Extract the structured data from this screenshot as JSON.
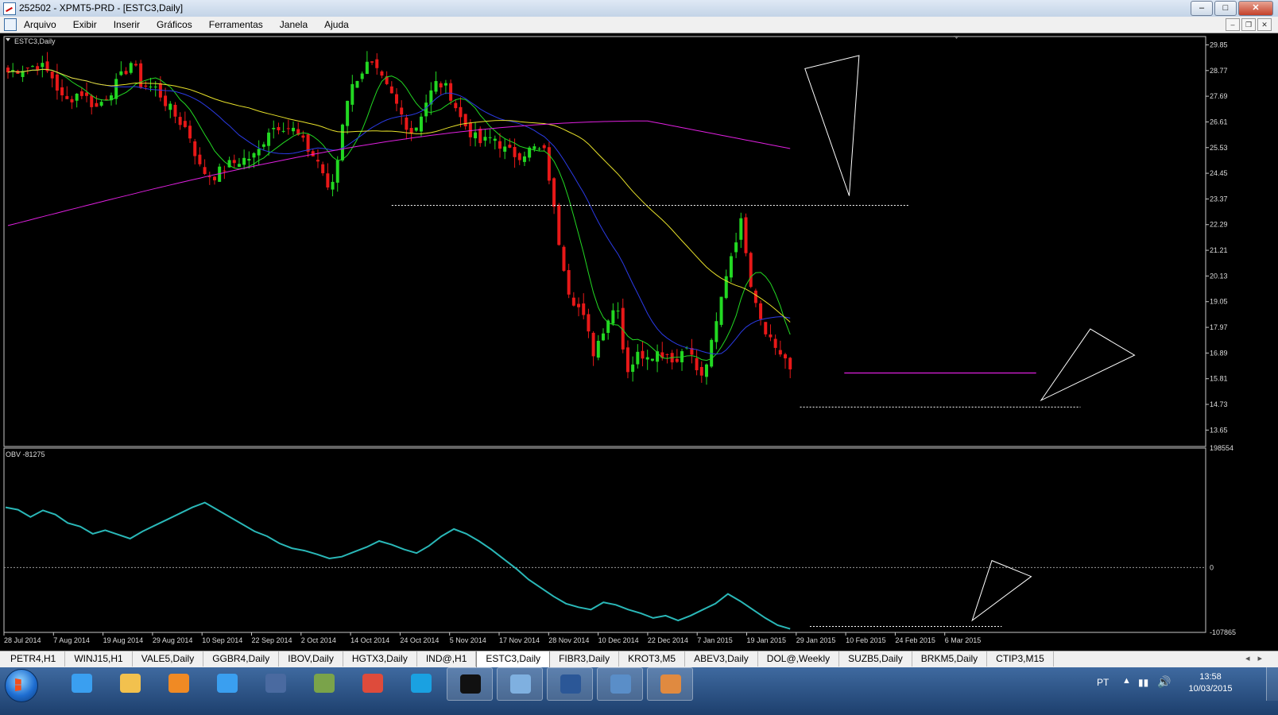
{
  "window": {
    "title": "252502 - XPMT5-PRD - [ESTC3,Daily]",
    "minimize": "–",
    "maximize": "□",
    "close": "✕"
  },
  "menu": {
    "items": [
      "Arquivo",
      "Exibir",
      "Inserir",
      "Gráficos",
      "Ferramentas",
      "Janela",
      "Ajuda"
    ]
  },
  "chart_data": [
    {
      "type": "candlestick",
      "title": "ESTC3,Daily",
      "ylim": [
        12.96,
        30.2
      ],
      "y_ticks": [
        "29.85",
        "28.77",
        "27.69",
        "26.61",
        "25.53",
        "24.45",
        "23.37",
        "22.29",
        "21.21",
        "20.13",
        "19.05",
        "17.97",
        "16.89",
        "15.81",
        "14.73",
        "13.65"
      ],
      "x_ticks": [
        "28 Jul 2014",
        "7 Aug 2014",
        "19 Aug 2014",
        "29 Aug 2014",
        "10 Sep 2014",
        "22 Sep 2014",
        "2 Oct 2014",
        "14 Oct 2014",
        "24 Oct 2014",
        "5 Nov 2014",
        "17 Nov 2014",
        "28 Nov 2014",
        "10 Dec 2014",
        "22 Dec 2014",
        "7 Jan 2015",
        "19 Jan 2015",
        "29 Jan 2015",
        "10 Feb 2015",
        "24 Feb 2015",
        "6 Mar 2015"
      ],
      "bar_count": 160,
      "close_anchors": [
        [
          0,
          28.7
        ],
        [
          4,
          28.9
        ],
        [
          8,
          29.0
        ],
        [
          11,
          28.5
        ],
        [
          14,
          27.4
        ],
        [
          18,
          27.9
        ],
        [
          22,
          27.2
        ],
        [
          27,
          28.2
        ],
        [
          31,
          29.2
        ],
        [
          33,
          28.2
        ],
        [
          37,
          28.0
        ],
        [
          41,
          27.0
        ],
        [
          45,
          26.2
        ],
        [
          48,
          24.6
        ],
        [
          51,
          24.3
        ],
        [
          55,
          24.8
        ],
        [
          58,
          25.0
        ],
        [
          62,
          25.2
        ],
        [
          65,
          26.3
        ],
        [
          68,
          26.5
        ],
        [
          71,
          26.3
        ],
        [
          75,
          25.4
        ],
        [
          78,
          24.8
        ],
        [
          80,
          23.5
        ],
        [
          82,
          24.8
        ],
        [
          84,
          27.4
        ],
        [
          87,
          28.5
        ],
        [
          90,
          29.1
        ],
        [
          93,
          28.4
        ],
        [
          96,
          27.6
        ],
        [
          99,
          26.6
        ],
        [
          101,
          26.1
        ],
        [
          104,
          27.4
        ],
        [
          107,
          28.3
        ],
        [
          110,
          27.9
        ],
        [
          113,
          26.7
        ],
        [
          116,
          26.0
        ],
        [
          118,
          25.7
        ],
        [
          121,
          26.0
        ],
        [
          124,
          25.4
        ],
        [
          127,
          25.2
        ],
        [
          131,
          25.5
        ],
        [
          134,
          25.3
        ],
        [
          137,
          21.9
        ],
        [
          140,
          19.4
        ],
        [
          143,
          18.6
        ],
        [
          146,
          16.9
        ],
        [
          149,
          18.2
        ],
        [
          152,
          19.0
        ],
        [
          154,
          16.1
        ],
        [
          157,
          16.8
        ],
        [
          160,
          16.9
        ],
        [
          164,
          16.9
        ],
        [
          167,
          16.5
        ],
        [
          169,
          17.5
        ],
        [
          171,
          16.4
        ],
        [
          173,
          15.8
        ],
        [
          176,
          17.6
        ],
        [
          179,
          20.2
        ],
        [
          181,
          21.5
        ],
        [
          183,
          22.5
        ],
        [
          185,
          20.0
        ],
        [
          188,
          18.2
        ],
        [
          191,
          17.2
        ],
        [
          194,
          16.6
        ],
        [
          195,
          16.0
        ]
      ],
      "indicators": [
        {
          "kind": "moving_average",
          "period": 9,
          "color": "#22d822"
        },
        {
          "kind": "moving_average",
          "period": 21,
          "color": "#2b3be6"
        },
        {
          "kind": "moving_average",
          "period": 50,
          "color": "#e8e22a"
        },
        {
          "kind": "moving_average",
          "period": 200,
          "color": "#e020e0"
        }
      ],
      "annotations": [
        {
          "kind": "support_line",
          "price": 23.1,
          "from_bar": 78,
          "to_bar": 183,
          "color": "#ffffff"
        },
        {
          "kind": "support_line",
          "price": 14.62,
          "from_bar": 161,
          "to_bar": 218,
          "color": "#ffffff"
        },
        {
          "kind": "horizontal_line",
          "price": 16.05,
          "from_bar": 170,
          "to_bar": 209,
          "color": "#e020e0"
        },
        {
          "kind": "triangle",
          "points": [
            [
              162,
              28.85
            ],
            [
              173,
              29.4
            ],
            [
              171,
              23.5
            ]
          ]
        },
        {
          "kind": "triangle",
          "points": [
            [
              210,
              14.9
            ],
            [
              220,
              17.9
            ],
            [
              229,
              16.8
            ]
          ]
        }
      ]
    },
    {
      "type": "line",
      "title": "OBV -81275",
      "ylim": [
        -107865,
        198554
      ],
      "y_ticks": [
        "198554",
        "0",
        "-107865"
      ],
      "series": [
        {
          "color": "#2ab8b8",
          "values": [
            100000,
            96000,
            84000,
            95000,
            88000,
            74000,
            68000,
            56000,
            62000,
            55000,
            48000,
            60000,
            70000,
            80000,
            90000,
            100000,
            108000,
            96000,
            84000,
            72000,
            60000,
            52000,
            40000,
            32000,
            28000,
            22000,
            15000,
            18000,
            26000,
            34000,
            44000,
            38000,
            30000,
            24000,
            36000,
            52000,
            64000,
            56000,
            44000,
            30000,
            14000,
            -2000,
            -20000,
            -34000,
            -48000,
            -60000,
            -66000,
            -70000,
            -58000,
            -62000,
            -70000,
            -76000,
            -84000,
            -80000,
            -88000,
            -80000,
            -70000,
            -60000,
            -44000,
            -56000,
            -70000,
            -84000,
            -96000,
            -102000
          ]
        },
        {
          "name": "OBV",
          "y": [
            0
          ]
        }
      ],
      "annotations": [
        {
          "kind": "support_line",
          "value": -98000,
          "from_bar": 163,
          "to_bar": 202,
          "color": "#ffffff"
        },
        {
          "kind": "triangle",
          "points": [
            [
              196,
              -88000
            ],
            [
              200,
              11500
            ],
            [
              208,
              -15000
            ]
          ]
        }
      ]
    }
  ],
  "tabs": [
    "PETR4,H1",
    "WINJ15,H1",
    "VALE5,Daily",
    "GGBR4,Daily",
    "IBOV,Daily",
    "HGTX3,Daily",
    "IND@,H1",
    "ESTC3,Daily",
    "FIBR3,Daily",
    "KROT3,M5",
    "ABEV3,Daily",
    "DOL@,Weekly",
    "SUZB5,Daily",
    "BRKM5,Daily",
    "CTIP3,M15"
  ],
  "active_tab": "ESTC3,Daily",
  "taskbar": {
    "apps": [
      {
        "icon": "internet-explorer-icon",
        "color": "#3a9ff0"
      },
      {
        "icon": "folder-icon",
        "color": "#f2c14e"
      },
      {
        "icon": "media-player-icon",
        "color": "#f08a24"
      },
      {
        "icon": "paper-plane-icon",
        "color": "#3a9ff0"
      },
      {
        "icon": "hp-icon",
        "color": "#4a6aa0"
      },
      {
        "icon": "cashier-icon",
        "color": "#7aa34a"
      },
      {
        "icon": "chrome-icon",
        "color": "#de4b3b"
      },
      {
        "icon": "skype-icon",
        "color": "#1aa1e1"
      },
      {
        "icon": "xp-icon",
        "color": "#111111"
      },
      {
        "icon": "chart-app-icon",
        "color": "#7fb0e0"
      },
      {
        "icon": "word-icon",
        "color": "#2b5797"
      },
      {
        "icon": "picture-icon",
        "color": "#5a8ec8"
      },
      {
        "icon": "paint-icon",
        "color": "#e08a40"
      }
    ],
    "lang": "PT",
    "time": "13:58",
    "date": "10/03/2015"
  },
  "colors": {
    "bull": "#22d822",
    "bear": "#e81818",
    "text": "#dddddd"
  }
}
